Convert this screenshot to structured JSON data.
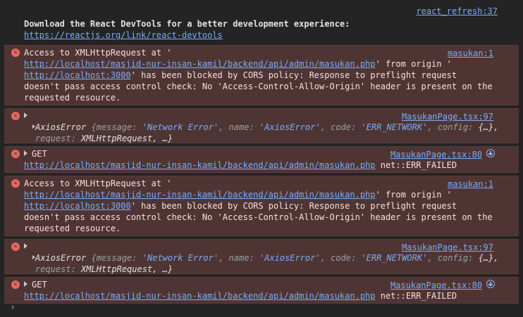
{
  "info": {
    "source": "react_refresh:37",
    "message": "Download the React DevTools for a better development experience:",
    "link": "https://reactjs.org/link/react-devtools"
  },
  "cors": {
    "source": "masukan:1",
    "prefix": "Access to XMLHttpRequest at '",
    "url": "http://localhost/masjid-nur-insan-kamil/backend/api/admin/masukan.php",
    "from_origin": "' from origin '",
    "origin": "http://localhost:3000",
    "rest": "' has been blocked by CORS policy: Response to preflight request doesn't pass access control check: No 'Access-Control-Allow-Origin' header is present on the requested resource."
  },
  "axios": {
    "source": "MasukanPage.tsx:97",
    "name_label": "AxiosError",
    "open": " {",
    "k_message": "message: ",
    "v_message": "'Network Error'",
    "k_name": ", name: ",
    "v_name": "'AxiosError'",
    "k_code": ", code: ",
    "v_code": "'ERR_NETWORK'",
    "k_config": ", config: ",
    "v_config": "{…},",
    "k_request": "request: ",
    "v_request": "XMLHttpRequest",
    "tail": ", …}"
  },
  "get": {
    "source": "MasukanPage.tsx:80",
    "method": "GET",
    "url": "http://localhost/masjid-nur-insan-kamil/backend/api/admin/masukan.php",
    "status": " net::ERR_FAILED"
  },
  "icons": {
    "error": "error-icon",
    "expand": "expand-triangle-icon",
    "network": "network-badge-icon",
    "prompt": "prompt-chevron-icon"
  },
  "colors": {
    "error_bg": "#4e3534",
    "link": "#7cacf8",
    "error_icon": "#e46962"
  },
  "prompt_glyph": "›"
}
